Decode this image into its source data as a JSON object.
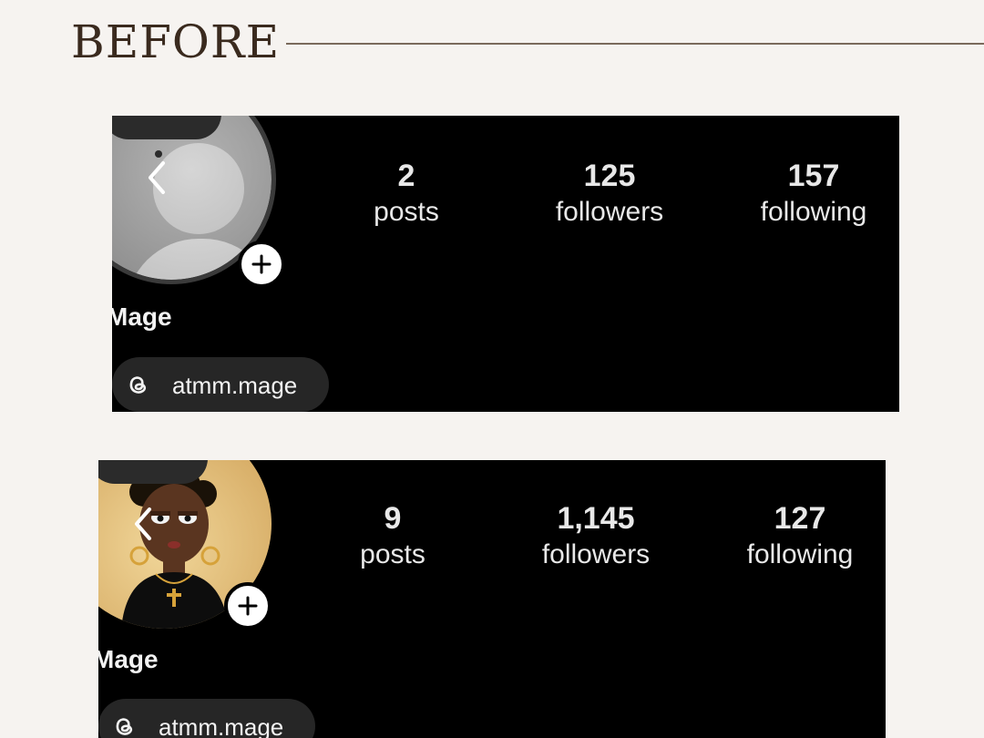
{
  "heading": "BEFORE",
  "profiles": [
    {
      "posts": {
        "value": "2",
        "label": "posts"
      },
      "followers": {
        "value": "125",
        "label": "followers"
      },
      "following": {
        "value": "157",
        "label": "following"
      },
      "name": "Mage",
      "threads_handle": "atmm.mage",
      "avatar": "default-placeholder-avatar"
    },
    {
      "posts": {
        "value": "9",
        "label": "posts"
      },
      "followers": {
        "value": "1,145",
        "label": "followers"
      },
      "following": {
        "value": "127",
        "label": "following"
      },
      "name": "Mage",
      "threads_handle": "atmm.mage",
      "avatar": "cartoon-character-avatar"
    }
  ],
  "icons": {
    "back": "chevron-left-icon",
    "add_story": "plus-icon",
    "threads": "threads-icon"
  },
  "colors": {
    "page_background": "#f6f3f0",
    "heading": "#3a2a1e",
    "panel": "#000000",
    "text": "#e8e8e8"
  }
}
